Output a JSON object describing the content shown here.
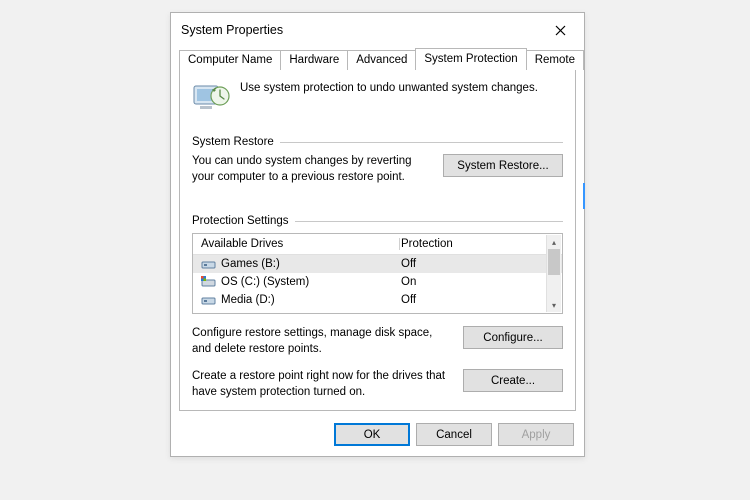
{
  "window": {
    "title": "System Properties"
  },
  "tabs": {
    "t0": "Computer Name",
    "t1": "Hardware",
    "t2": "Advanced",
    "t3": "System Protection",
    "t4": "Remote"
  },
  "intro": "Use system protection to undo unwanted system changes.",
  "restore": {
    "header": "System Restore",
    "text": "You can undo system changes by reverting your computer to a previous restore point.",
    "button": "System Restore..."
  },
  "settings": {
    "header": "Protection Settings",
    "col1": "Available Drives",
    "col2": "Protection",
    "drives": [
      {
        "name": "Games (B:)",
        "protection": "Off"
      },
      {
        "name": "OS (C:) (System)",
        "protection": "On"
      },
      {
        "name": "Media (D:)",
        "protection": "Off"
      }
    ],
    "configure_text": "Configure restore settings, manage disk space, and delete restore points.",
    "configure_button": "Configure...",
    "create_text": "Create a restore point right now for the drives that have system protection turned on.",
    "create_button": "Create..."
  },
  "buttons": {
    "ok": "OK",
    "cancel": "Cancel",
    "apply": "Apply"
  }
}
